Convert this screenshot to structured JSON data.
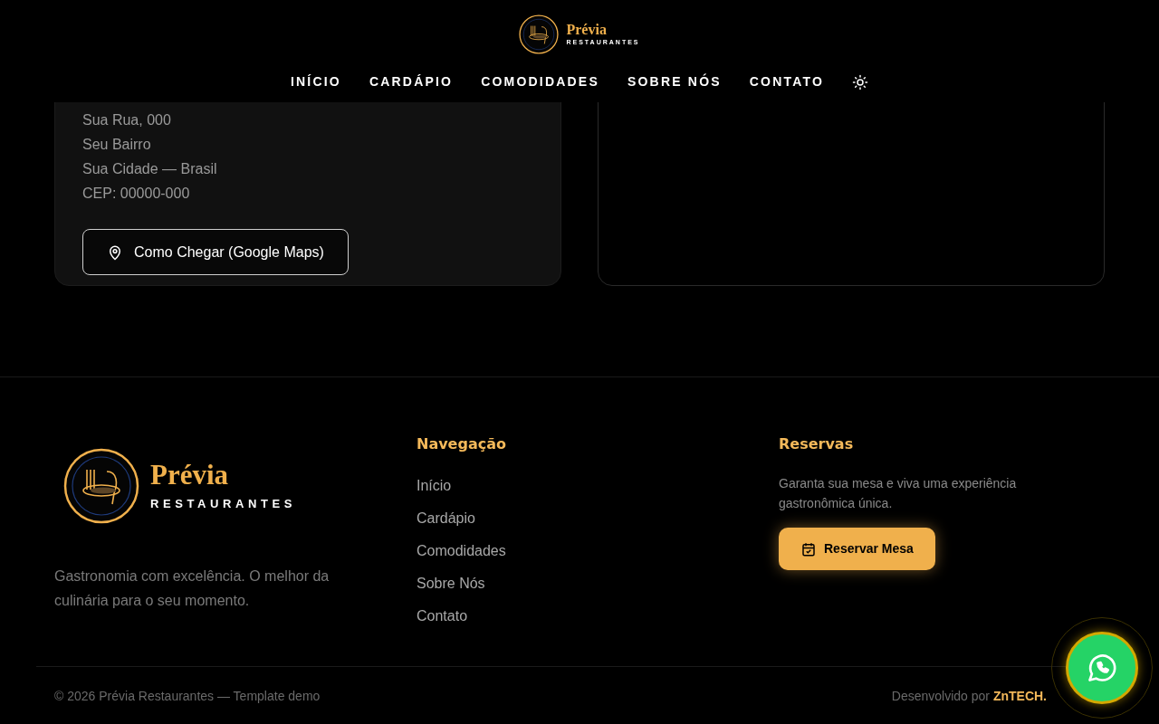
{
  "header": {
    "brand": {
      "name": "Prévia",
      "tagline": "RESTAURANTES"
    },
    "nav": [
      {
        "label": "INÍCIO"
      },
      {
        "label": "CARDÁPIO"
      },
      {
        "label": "COMODIDADES"
      },
      {
        "label": "SOBRE NÓS"
      },
      {
        "label": "CONTATO"
      }
    ]
  },
  "address_card": {
    "lines": [
      "Sua Rua, 000",
      "Seu Bairro",
      "Sua Cidade — Brasil",
      "CEP: 00000-000"
    ],
    "button": "Como Chegar (Google Maps)"
  },
  "footer": {
    "brand": {
      "name": "Prévia",
      "tagline": "RESTAURANTES"
    },
    "description": "Gastronomia com excelência. O melhor da culinária para o seu momento.",
    "navigation": {
      "title": "Navegação",
      "links": [
        "Início",
        "Cardápio",
        "Comodidades",
        "Sobre Nós",
        "Contato"
      ]
    },
    "reservations": {
      "title": "Reservas",
      "text": "Garanta sua mesa e viva uma experiência gastronômica única.",
      "button": "Reservar Mesa"
    },
    "copyright": "© 2026 Prévia Restaurantes — Template demo",
    "credit": {
      "prefix": "Desenvolvido por",
      "name": "ZnTECH."
    }
  }
}
